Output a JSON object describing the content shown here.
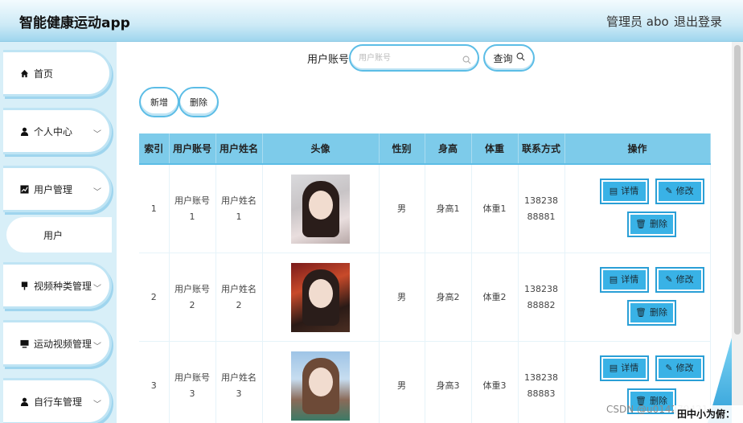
{
  "header": {
    "title": "智能健康运动app",
    "admin": "管理员 abo",
    "logout": "退出登录"
  },
  "sidebar": {
    "items": [
      {
        "label": "首页",
        "icon": "home-icon",
        "has_children": false
      },
      {
        "label": "个人中心",
        "icon": "user-icon",
        "has_children": true
      },
      {
        "label": "用户管理",
        "icon": "chart-icon",
        "has_children": true
      },
      {
        "label": "用户",
        "sub": true
      },
      {
        "label": "视频种类管理",
        "icon": "pin-icon",
        "has_children": true
      },
      {
        "label": "运动视频管理",
        "icon": "monitor-icon",
        "has_children": true
      },
      {
        "label": "自行车管理",
        "icon": "user-icon",
        "has_children": true
      }
    ]
  },
  "search": {
    "label": "用户账号",
    "placeholder": "用户账号",
    "value": "",
    "button": "查询"
  },
  "toolbar": {
    "add": "新增",
    "delete": "删除"
  },
  "table": {
    "columns": [
      "索引",
      "用户账号",
      "用户姓名",
      "头像",
      "性别",
      "身高",
      "体重",
      "联系方式",
      "操作"
    ],
    "rows": [
      {
        "index": "1",
        "account": "用户账号1",
        "name": "用户姓名1",
        "gender": "男",
        "height": "身高1",
        "weight": "体重1",
        "phone": "13823888881"
      },
      {
        "index": "2",
        "account": "用户账号2",
        "name": "用户姓名2",
        "gender": "男",
        "height": "身高2",
        "weight": "体重2",
        "phone": "13823888882"
      },
      {
        "index": "3",
        "account": "用户账号3",
        "name": "用户姓名3",
        "gender": "男",
        "height": "身高3",
        "weight": "体重3",
        "phone": "13823888883"
      }
    ],
    "actions": {
      "detail": "详情",
      "edit": "修改",
      "delete": "删除"
    }
  },
  "overlay": {
    "watermark": "CSDN @u014279421",
    "tag": "田中小为俯："
  },
  "colors": {
    "accent": "#39b2e6",
    "header_bg": "#cdeaf6",
    "table_header": "#7dcbea"
  }
}
